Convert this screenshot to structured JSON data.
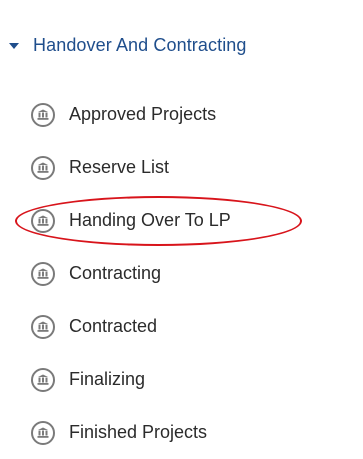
{
  "section": {
    "label": "Handover And Contracting",
    "expanded": true
  },
  "items": [
    {
      "label": "Approved Projects",
      "icon": "building-icon"
    },
    {
      "label": "Reserve List",
      "icon": "building-icon"
    },
    {
      "label": "Handing Over To LP",
      "icon": "building-icon",
      "highlighted": true
    },
    {
      "label": "Contracting",
      "icon": "building-icon"
    },
    {
      "label": "Contracted",
      "icon": "building-icon"
    },
    {
      "label": "Finalizing",
      "icon": "building-icon"
    },
    {
      "label": "Finished Projects",
      "icon": "building-icon"
    }
  ],
  "colors": {
    "section_text": "#1f4e8c",
    "item_text": "#2b2b2b",
    "icon": "#7a7a7a",
    "highlight": "#d8141b"
  }
}
